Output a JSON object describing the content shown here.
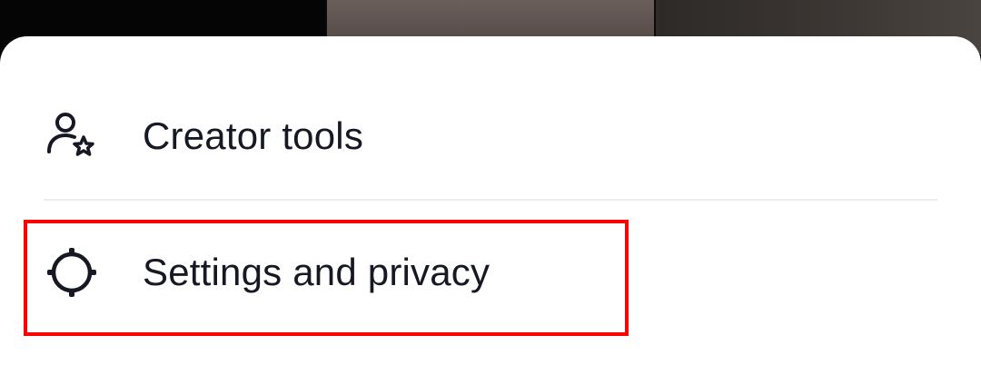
{
  "menu": {
    "items": [
      {
        "label": "Creator tools",
        "icon": "creator-tools-icon"
      },
      {
        "label": "Settings and privacy",
        "icon": "gear-icon"
      }
    ]
  },
  "colors": {
    "sheet_background": "#ffffff",
    "text": "#161823",
    "divider": "#ececec",
    "highlight_border": "#ff0000"
  }
}
